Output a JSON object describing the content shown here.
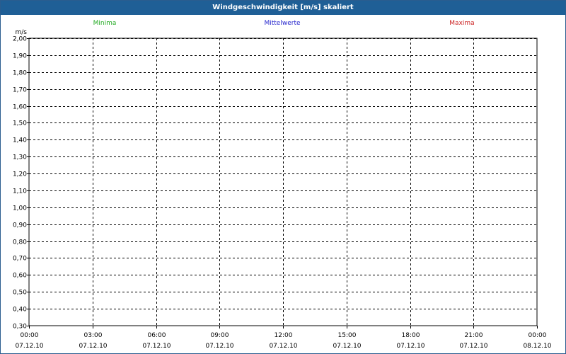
{
  "window": {
    "title": "Windgeschwindigkeit [m/s] skaliert"
  },
  "chart_data": {
    "type": "line",
    "title": "Windgeschwindigkeit [m/s] skaliert",
    "ylabel": "m/s",
    "xlabel": "",
    "ylim": [
      0.3,
      2.0
    ],
    "y_ticks": [
      "0,30",
      "0,40",
      "0,50",
      "0,60",
      "0,70",
      "0,80",
      "0,90",
      "1,00",
      "1,10",
      "1,20",
      "1,30",
      "1,40",
      "1,50",
      "1,60",
      "1,70",
      "1,80",
      "1,90",
      "2,00"
    ],
    "x_ticks": [
      {
        "time": "00:00",
        "date": "07.12.10"
      },
      {
        "time": "03:00",
        "date": "07.12.10"
      },
      {
        "time": "06:00",
        "date": "07.12.10"
      },
      {
        "time": "09:00",
        "date": "07.12.10"
      },
      {
        "time": "12:00",
        "date": "07.12.10"
      },
      {
        "time": "15:00",
        "date": "07.12.10"
      },
      {
        "time": "18:00",
        "date": "07.12.10"
      },
      {
        "time": "21:00",
        "date": "07.12.10"
      },
      {
        "time": "00:00",
        "date": "08.12.10"
      }
    ],
    "grid": true,
    "legend_position": "top",
    "series": [
      {
        "name": "Minima",
        "color": "#22aa22",
        "values": []
      },
      {
        "name": "Mittelwerte",
        "color": "#2222cc",
        "values": []
      },
      {
        "name": "Maxima",
        "color": "#cc2222",
        "values": []
      }
    ]
  }
}
